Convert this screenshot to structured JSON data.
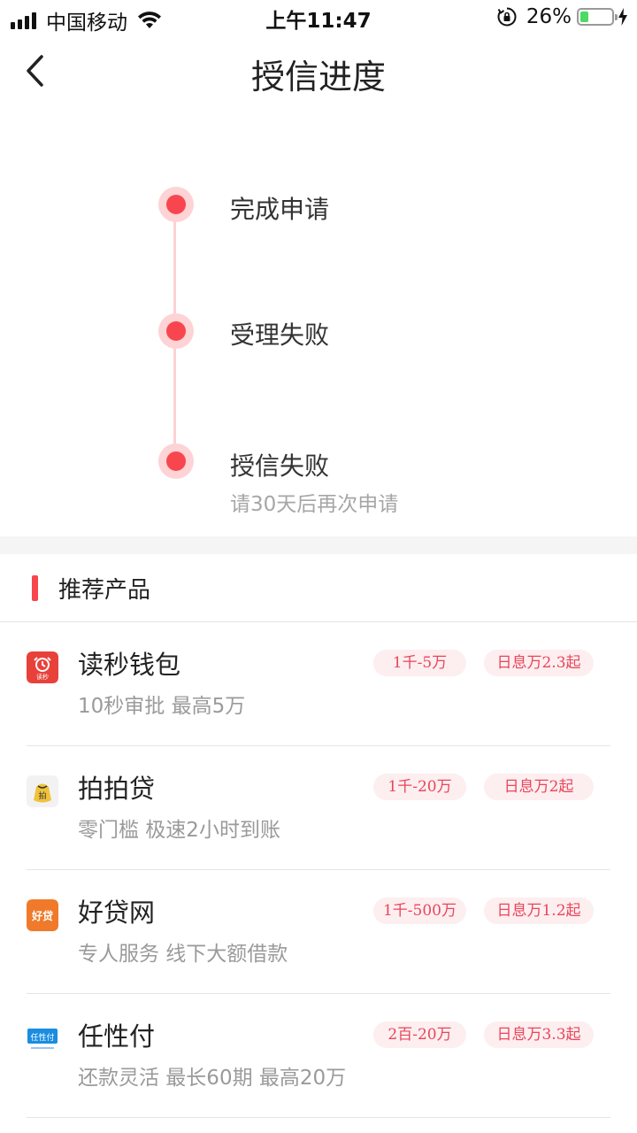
{
  "status_bar": {
    "carrier": "中国移动",
    "time": "上午11:47",
    "battery_percent": "26%",
    "battery_level": 0.26,
    "battery_color": "#4cd964"
  },
  "nav": {
    "title": "授信进度",
    "back_icon": "chevron-left-icon"
  },
  "timeline": {
    "accent_color": "#f8464f",
    "steps": [
      {
        "label": "完成申请",
        "sub": ""
      },
      {
        "label": "受理失败",
        "sub": ""
      },
      {
        "label": "授信失败",
        "sub": "请30天后再次申请"
      }
    ]
  },
  "recommend": {
    "title": "推荐产品",
    "products": [
      {
        "name": "读秒钱包",
        "desc": "10秒审批 最高5万",
        "amount": "1千-5万",
        "rate": "日息万2.3起",
        "icon": "dumiao-icon",
        "icon_text": "读秒",
        "icon_color": "#e8413a"
      },
      {
        "name": "拍拍贷",
        "desc": "零门槛 极速2小时到账",
        "amount": "1千-20万",
        "rate": "日息万2起",
        "icon": "paipaidai-icon",
        "icon_text": "拍",
        "icon_color": "#f0c23a"
      },
      {
        "name": "好贷网",
        "desc": "专人服务 线下大额借款",
        "amount": "1千-500万",
        "rate": "日息万1.2起",
        "icon": "haodai-icon",
        "icon_text": "好贷",
        "icon_color": "#f07a2a"
      },
      {
        "name": "任性付",
        "desc": "还款灵活 最长60期 最高20万",
        "amount": "2百-20万",
        "rate": "日息万3.3起",
        "icon": "renxingfu-icon",
        "icon_text": "任性付",
        "icon_color": "#1a8de0"
      }
    ]
  }
}
